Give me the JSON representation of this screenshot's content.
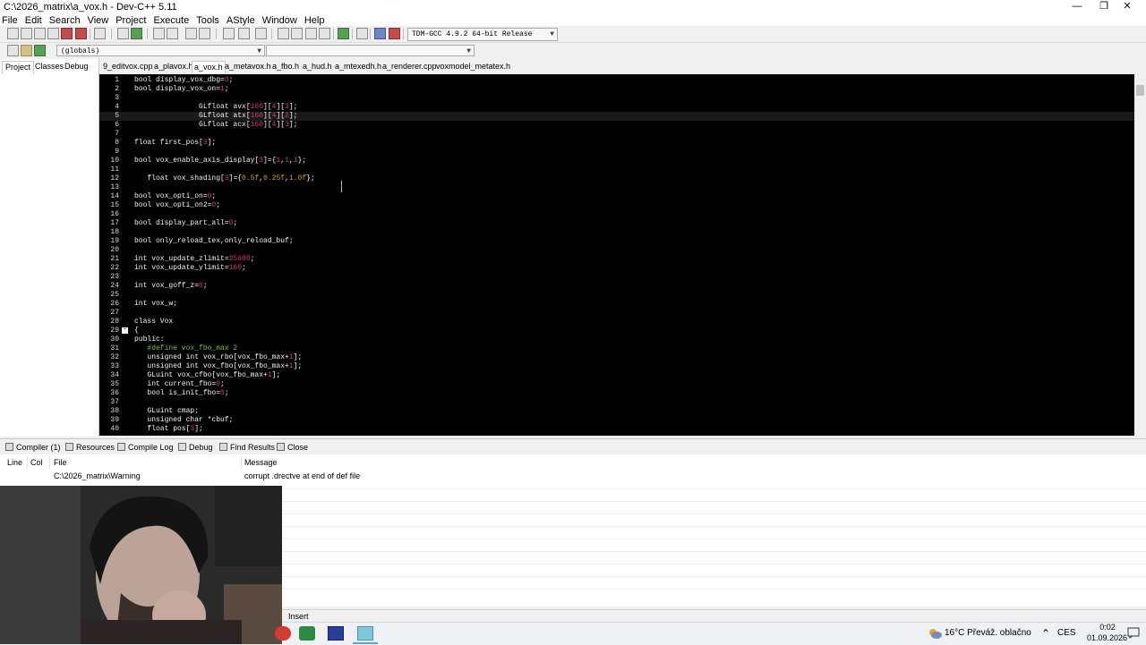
{
  "window": {
    "title": "C:\\2026_matrix\\a_vox.h - Dev-C++ 5.11",
    "minimize": "—",
    "restore": "❐",
    "close": "✕"
  },
  "menu": [
    "File",
    "Edit",
    "Search",
    "View",
    "Project",
    "Execute",
    "Tools",
    "AStyle",
    "Window",
    "Help"
  ],
  "toolbar": {
    "compiler_select": "TDM-GCC 4.9.2 64-bit Release",
    "scope_select": "(globals)"
  },
  "left_tabs": [
    "Project",
    "Classes",
    "Debug"
  ],
  "file_tabs": [
    "9_editvox.cpp",
    "a_plavox.h",
    "a_vox.h",
    "a_metavox.h",
    "a_fbo.h",
    "a_hud.h",
    "a_mtexedh.h",
    "a_renderer.cpp",
    "voxmodel_metatex.h"
  ],
  "active_file_tab": "a_vox.h",
  "editor": {
    "current_line": 5,
    "lines": [
      {
        "n": "1",
        "segs": [
          [
            "t",
            "bool display_vox_dbg="
          ],
          [
            "n",
            "0"
          ],
          [
            "t",
            ";"
          ]
        ]
      },
      {
        "n": "2",
        "segs": [
          [
            "t",
            "bool display_vox_on="
          ],
          [
            "n",
            "1"
          ],
          [
            "t",
            ";"
          ]
        ]
      },
      {
        "n": "3",
        "segs": []
      },
      {
        "n": "4",
        "segs": [
          [
            "t",
            "               GLfloat avx["
          ],
          [
            "n",
            "160"
          ],
          [
            "t",
            "]["
          ],
          [
            "n",
            "4"
          ],
          [
            "t",
            "]["
          ],
          [
            "n",
            "3"
          ],
          [
            "t",
            "];"
          ]
        ]
      },
      {
        "n": "5",
        "segs": [
          [
            "t",
            "               GLfloat atx["
          ],
          [
            "n",
            "160"
          ],
          [
            "t",
            "]["
          ],
          [
            "n",
            "4"
          ],
          [
            "t",
            "]["
          ],
          [
            "n",
            "2"
          ],
          [
            "t",
            "];"
          ]
        ]
      },
      {
        "n": "6",
        "segs": [
          [
            "t",
            "               GLfloat acx["
          ],
          [
            "n",
            "160"
          ],
          [
            "t",
            "]["
          ],
          [
            "n",
            "4"
          ],
          [
            "t",
            "]["
          ],
          [
            "n",
            "3"
          ],
          [
            "t",
            "];"
          ]
        ]
      },
      {
        "n": "7",
        "segs": []
      },
      {
        "n": "8",
        "segs": [
          [
            "t",
            "float first_pos["
          ],
          [
            "n",
            "3"
          ],
          [
            "t",
            "];"
          ]
        ]
      },
      {
        "n": "9",
        "segs": []
      },
      {
        "n": "10",
        "segs": [
          [
            "t",
            "bool vox_enable_axis_display["
          ],
          [
            "n",
            "3"
          ],
          [
            "t",
            "]={"
          ],
          [
            "n",
            "1"
          ],
          [
            "t",
            ","
          ],
          [
            "n",
            "1"
          ],
          [
            "t",
            ","
          ],
          [
            "n",
            "1"
          ],
          [
            "t",
            "};"
          ]
        ]
      },
      {
        "n": "11",
        "segs": []
      },
      {
        "n": "12",
        "segs": [
          [
            "t",
            "   float vox_shading["
          ],
          [
            "n",
            "3"
          ],
          [
            "t",
            "]={"
          ],
          [
            "f",
            "0.5f"
          ],
          [
            "t",
            ","
          ],
          [
            "f",
            "0.25f"
          ],
          [
            "t",
            ","
          ],
          [
            "f",
            "1.0f"
          ],
          [
            "t",
            "};"
          ]
        ]
      },
      {
        "n": "13",
        "segs": []
      },
      {
        "n": "14",
        "segs": [
          [
            "t",
            "bool vox_opti_on="
          ],
          [
            "n",
            "0"
          ],
          [
            "t",
            ";"
          ]
        ]
      },
      {
        "n": "15",
        "segs": [
          [
            "t",
            "bool vox_opti_on2="
          ],
          [
            "n",
            "0"
          ],
          [
            "t",
            ";"
          ]
        ]
      },
      {
        "n": "16",
        "segs": []
      },
      {
        "n": "17",
        "segs": [
          [
            "t",
            "bool display_part_all="
          ],
          [
            "n",
            "0"
          ],
          [
            "t",
            ";"
          ]
        ]
      },
      {
        "n": "18",
        "segs": []
      },
      {
        "n": "19",
        "segs": [
          [
            "t",
            "bool only_reload_tex,only_reload_buf;"
          ]
        ]
      },
      {
        "n": "20",
        "segs": []
      },
      {
        "n": "21",
        "segs": [
          [
            "t",
            "int vox_update_zlimit="
          ],
          [
            "n",
            "25600"
          ],
          [
            "t",
            ";"
          ]
        ]
      },
      {
        "n": "22",
        "segs": [
          [
            "t",
            "int vox_update_ylimit="
          ],
          [
            "n",
            "160"
          ],
          [
            "t",
            ";"
          ]
        ]
      },
      {
        "n": "23",
        "segs": []
      },
      {
        "n": "24",
        "segs": [
          [
            "t",
            "int vox_goff_z="
          ],
          [
            "n",
            "0"
          ],
          [
            "t",
            ";"
          ]
        ]
      },
      {
        "n": "25",
        "segs": []
      },
      {
        "n": "26",
        "segs": [
          [
            "t",
            "int vox_w;"
          ]
        ]
      },
      {
        "n": "27",
        "segs": []
      },
      {
        "n": "28",
        "segs": [
          [
            "t",
            "class Vox"
          ]
        ]
      },
      {
        "n": "29",
        "segs": [
          [
            "t",
            "{"
          ]
        ],
        "fold": "−"
      },
      {
        "n": "30",
        "segs": [
          [
            "t",
            "public:"
          ]
        ]
      },
      {
        "n": "31",
        "segs": [
          [
            "p",
            "   #define vox_fbo_max 2"
          ]
        ]
      },
      {
        "n": "32",
        "segs": [
          [
            "t",
            "   unsigned int vox_rbo[vox_fbo_max+"
          ],
          [
            "n",
            "1"
          ],
          [
            "t",
            "];"
          ]
        ]
      },
      {
        "n": "33",
        "segs": [
          [
            "t",
            "   unsigned int vox_fbo[vox_fbo_max+"
          ],
          [
            "n",
            "1"
          ],
          [
            "t",
            "];"
          ]
        ]
      },
      {
        "n": "34",
        "segs": [
          [
            "t",
            "   GLuint vox_cfbo[vox_fbo_max+"
          ],
          [
            "n",
            "1"
          ],
          [
            "t",
            "];"
          ]
        ]
      },
      {
        "n": "35",
        "segs": [
          [
            "t",
            "   int current_fbo="
          ],
          [
            "n",
            "0"
          ],
          [
            "t",
            ";"
          ]
        ]
      },
      {
        "n": "36",
        "segs": [
          [
            "t",
            "   bool is_init_fbo="
          ],
          [
            "n",
            "0"
          ],
          [
            "t",
            ";"
          ]
        ]
      },
      {
        "n": "37",
        "segs": []
      },
      {
        "n": "38",
        "segs": [
          [
            "t",
            "   GLuint cmap;"
          ]
        ]
      },
      {
        "n": "39",
        "segs": [
          [
            "t",
            "   unsigned char *cbuf;"
          ]
        ]
      },
      {
        "n": "40",
        "segs": [
          [
            "t",
            "   float pos["
          ],
          [
            "n",
            "3"
          ],
          [
            "t",
            "];"
          ]
        ]
      }
    ]
  },
  "bottom_tabs": [
    "Compiler (1)",
    "Resources",
    "Compile Log",
    "Debug",
    "Find Results",
    "Close"
  ],
  "messages": {
    "columns": [
      "Line",
      "Col",
      "File",
      "Message"
    ],
    "rows": [
      {
        "line": "",
        "col": "",
        "file": "C:\\2026_matrix\\Warning",
        "message": "corrupt .drectve at end of def file"
      }
    ]
  },
  "status": {
    "mode": "Insert"
  },
  "taskbar": {
    "weather": "16°C  Převáž. oblačno",
    "lang": "CES",
    "time": "0:02",
    "date": "01.09.2026",
    "tray_chevron": "⌃"
  },
  "colors": {
    "editor_bg": "#000000",
    "keyword_number": "#d43a7e",
    "float_literal": "#d4a020",
    "preprocessor": "#7bbd35"
  }
}
